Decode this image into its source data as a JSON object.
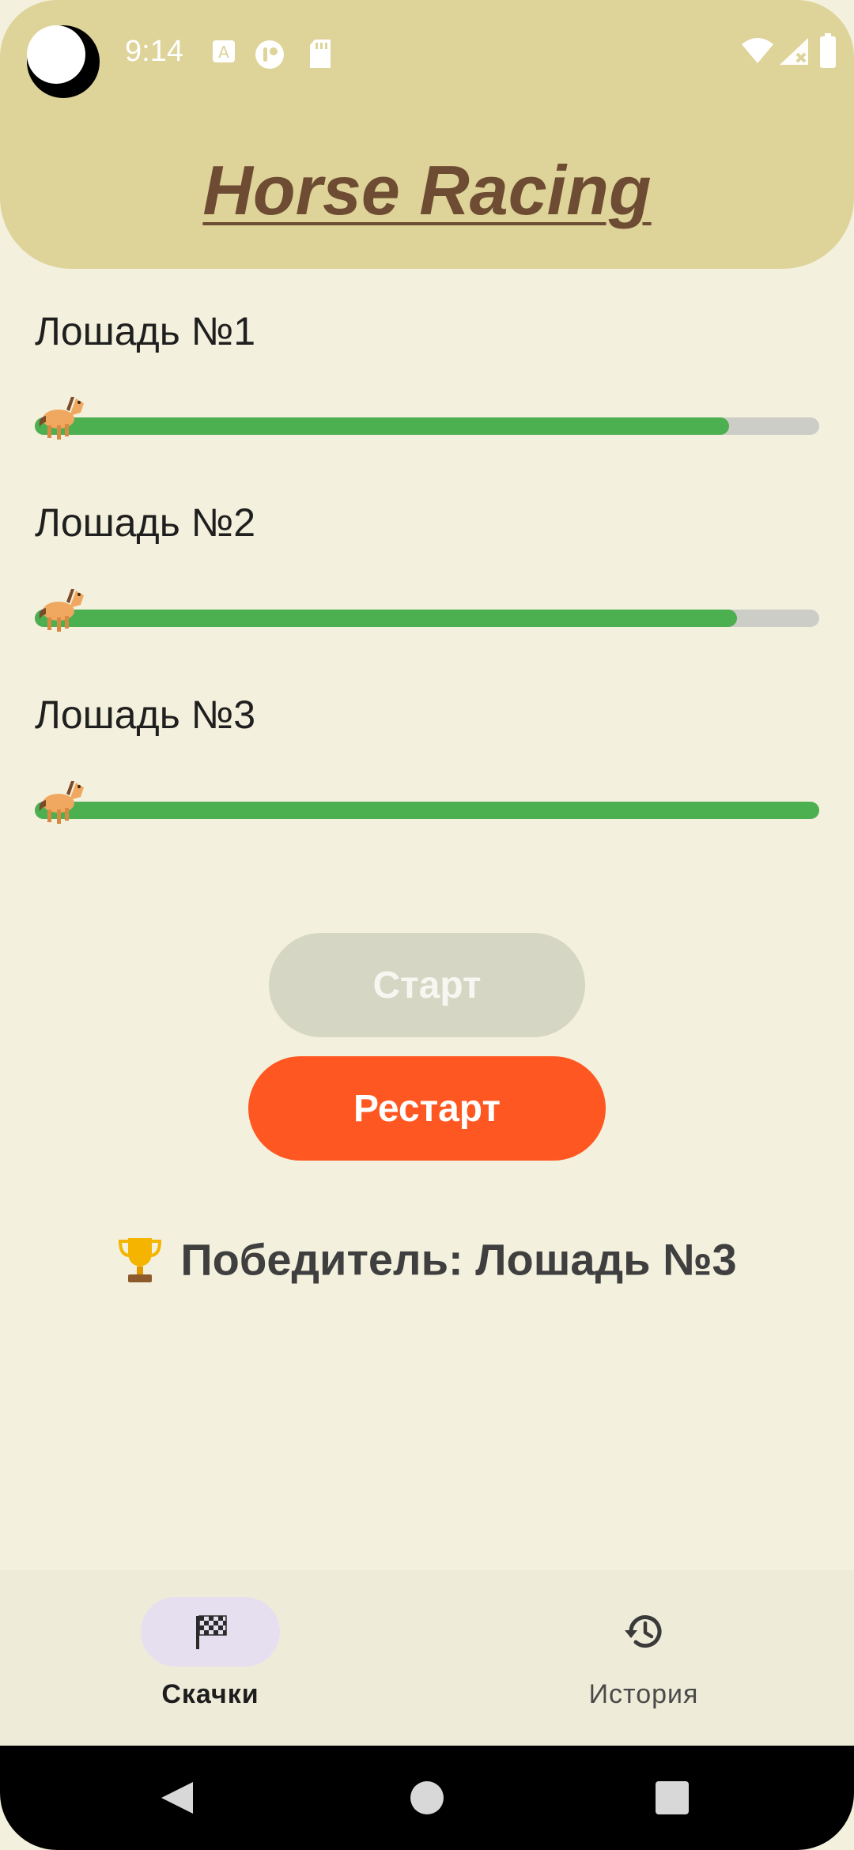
{
  "status_bar": {
    "time": "9:14"
  },
  "header": {
    "title": "Horse Racing"
  },
  "race": {
    "horses": [
      {
        "label": "Лошадь №1",
        "progress": 0.885
      },
      {
        "label": "Лошадь №2",
        "progress": 0.895
      },
      {
        "label": "Лошадь №3",
        "progress": 1.0
      }
    ],
    "horse_icon": "horse-emoji"
  },
  "buttons": {
    "start": "Старт",
    "restart": "Рестарт"
  },
  "winner": {
    "text": "Победитель: Лошадь №3",
    "icon": "trophy-emoji"
  },
  "bottom_nav": {
    "items": [
      {
        "label": "Скачки",
        "icon": "checkered-flag-icon",
        "active": true
      },
      {
        "label": "История",
        "icon": "history-icon",
        "active": false
      }
    ]
  },
  "colors": {
    "header_bg": "#ded399",
    "page_bg": "#f3f1dd",
    "title": "#6d4c33",
    "progress_fill": "#4caf50",
    "progress_track": "#cdcdc8",
    "start_disabled": "#d6d6c4",
    "restart": "#ff5722",
    "nav_active_pill": "#e6dff0"
  }
}
